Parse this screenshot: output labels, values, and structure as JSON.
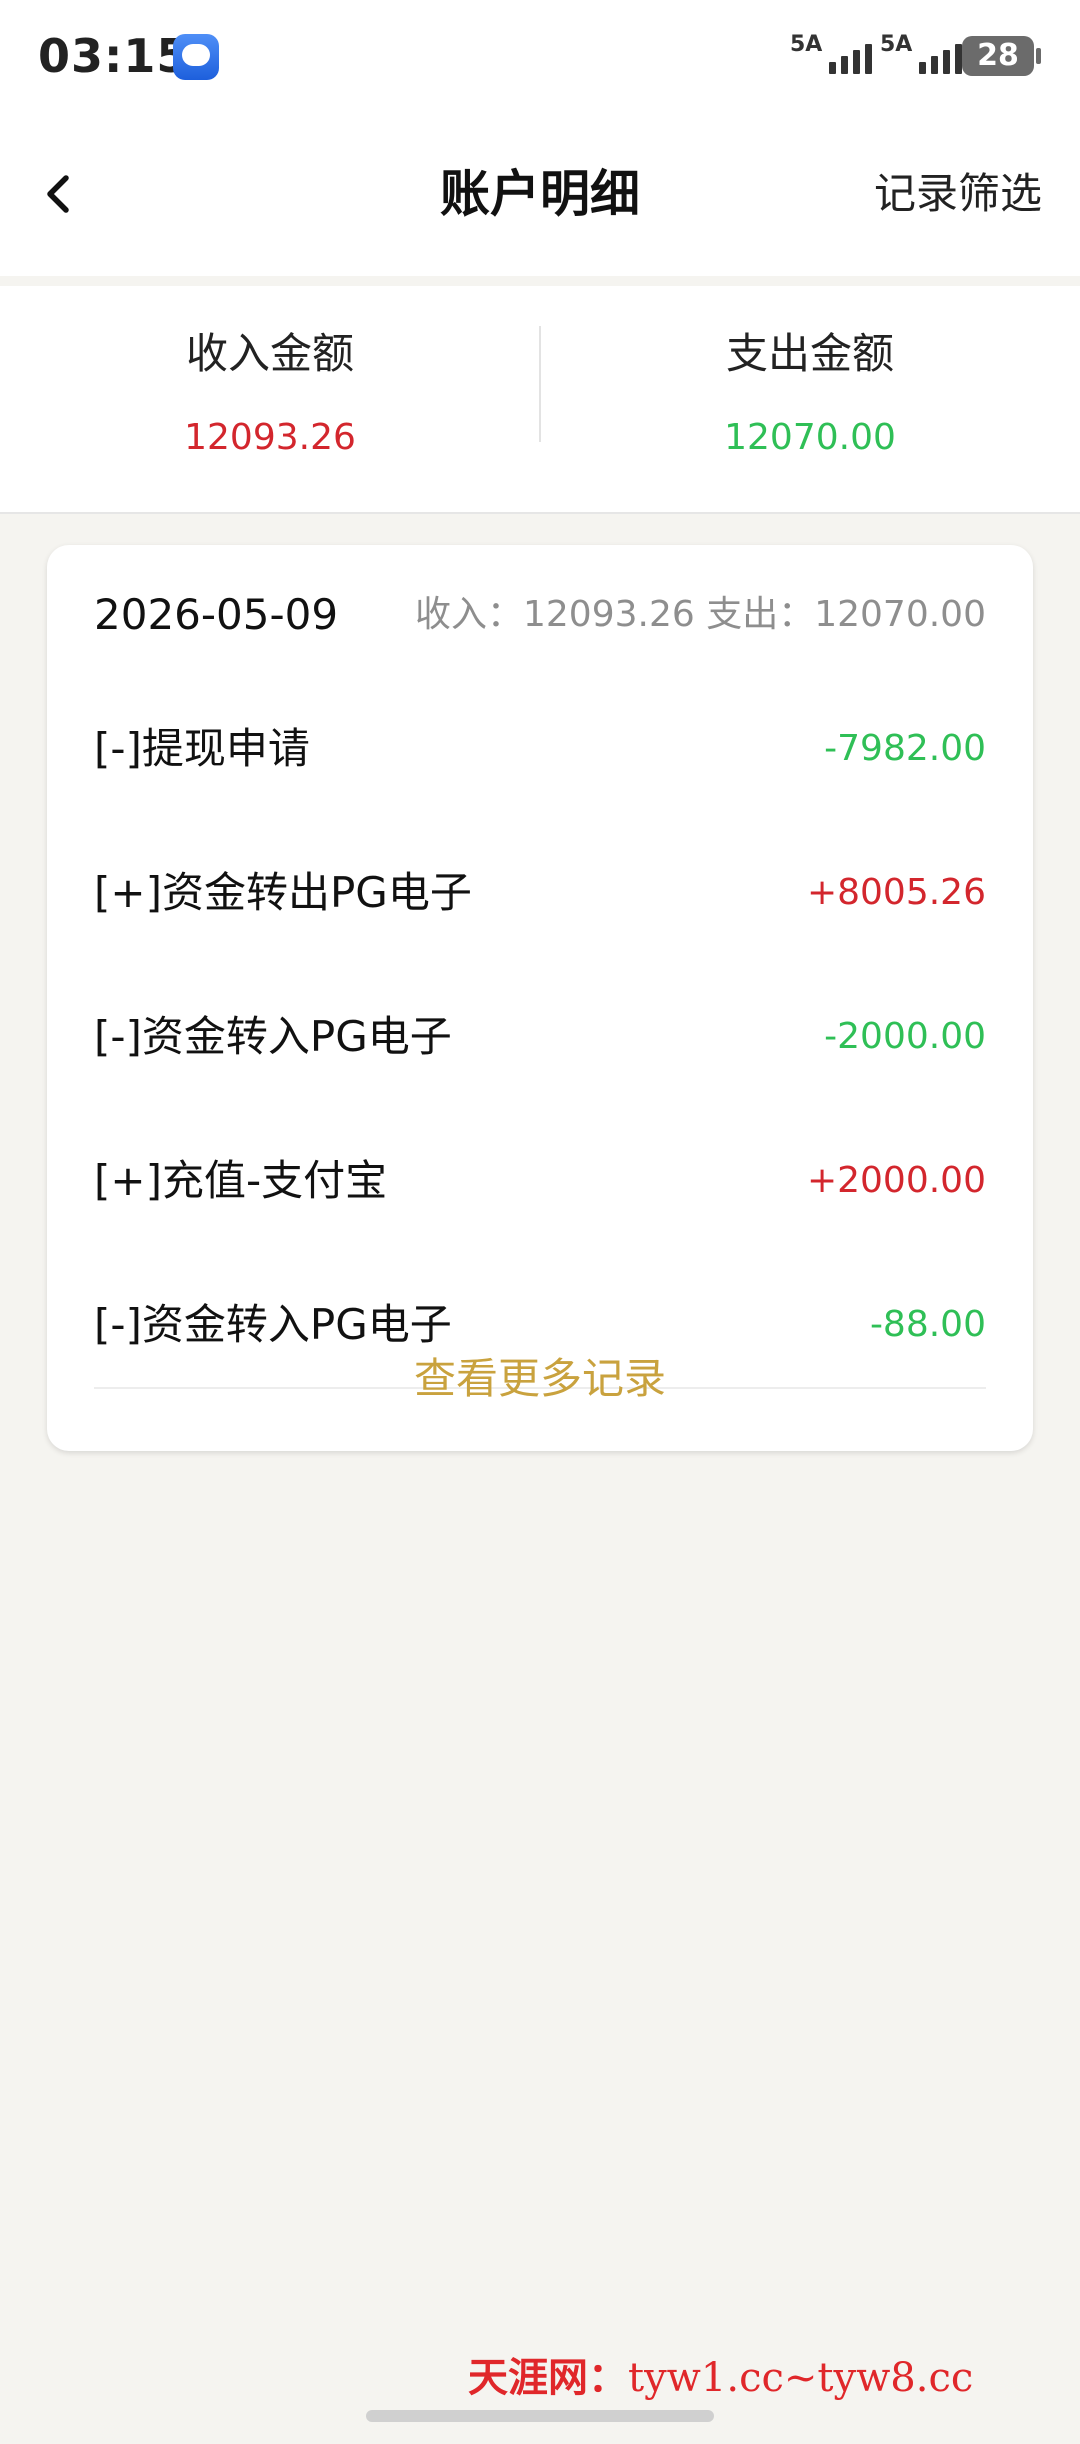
{
  "status_bar": {
    "time": "03:15",
    "network_1": "5A",
    "network_2": "5A",
    "battery": "28"
  },
  "nav": {
    "title": "账户明细",
    "filter_label": "记录筛选"
  },
  "summary": {
    "income_label": "收入金额",
    "income_value": "12093.26",
    "expense_label": "支出金额",
    "expense_value": "12070.00"
  },
  "day_card": {
    "date": "2026-05-09",
    "stats": "收入：12093.26 支出：12070.00",
    "transactions": [
      {
        "name": "[-]提现申请",
        "amount": "-7982.00"
      },
      {
        "name": "[+]资金转出PG电子",
        "amount": "+8005.26"
      },
      {
        "name": "[-]资金转入PG电子",
        "amount": "-2000.00"
      },
      {
        "name": "[+]充值-支付宝",
        "amount": "+2000.00"
      },
      {
        "name": "[-]资金转入PG电子",
        "amount": "-88.00"
      }
    ],
    "more_label": "查看更多记录"
  },
  "watermark": {
    "brand": "天涯网：",
    "domains": "tyw1.cc~tyw8.cc"
  },
  "colors": {
    "income": "#d3262d",
    "expense": "#2fbf56",
    "accent": "#c9a23e",
    "watermark": "#e0272a"
  }
}
